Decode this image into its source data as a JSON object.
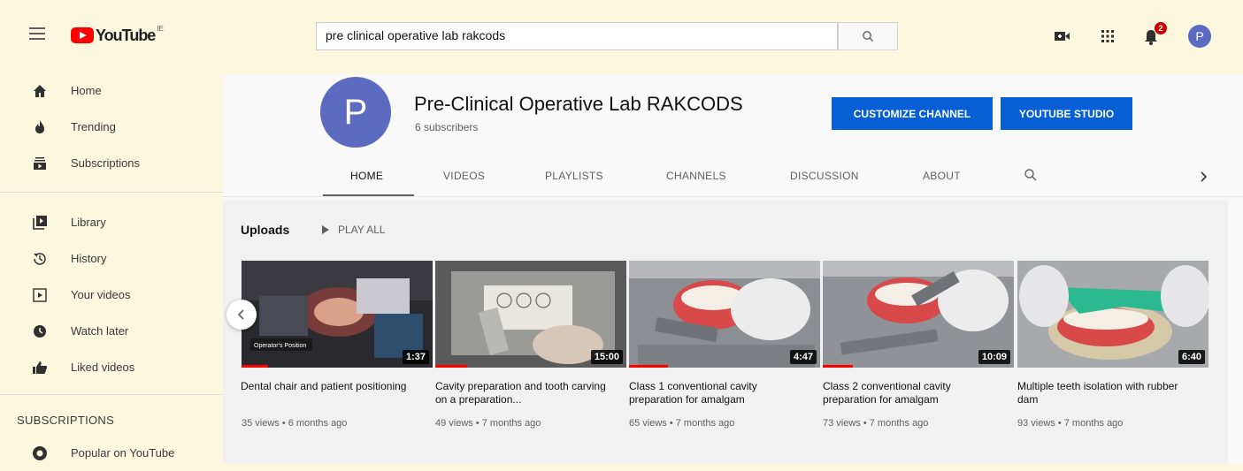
{
  "header": {
    "logo_text": "YouTube",
    "logo_superscript": "IE",
    "search_value": "pre clinical operative lab rakcods",
    "notification_count": "2",
    "avatar_letter": "P"
  },
  "sidebar": {
    "items": [
      {
        "label": "Home",
        "icon": "home-icon"
      },
      {
        "label": "Trending",
        "icon": "fire-icon"
      },
      {
        "label": "Subscriptions",
        "icon": "subscriptions-icon"
      },
      {
        "label": "Library",
        "icon": "library-icon"
      },
      {
        "label": "History",
        "icon": "history-icon"
      },
      {
        "label": "Your videos",
        "icon": "play-square-icon"
      },
      {
        "label": "Watch later",
        "icon": "clock-icon"
      },
      {
        "label": "Liked videos",
        "icon": "thumb-up-icon"
      }
    ],
    "subscriptions_heading": "SUBSCRIPTIONS",
    "subscription_items": [
      {
        "label": "Popular on YouTube"
      }
    ]
  },
  "channel": {
    "avatar_letter": "P",
    "name": "Pre-Clinical Operative Lab RAKCODS",
    "subscribers": "6 subscribers",
    "customize_label": "CUSTOMIZE CHANNEL",
    "studio_label": "YOUTUBE STUDIO",
    "tabs": [
      "HOME",
      "VIDEOS",
      "PLAYLISTS",
      "CHANNELS",
      "DISCUSSION",
      "ABOUT"
    ],
    "active_tab": "HOME"
  },
  "uploads": {
    "title": "Uploads",
    "play_all": "PLAY ALL",
    "videos": [
      {
        "title": "Dental chair and patient positioning",
        "meta": "35 views • 6 months ago",
        "duration": "1:37",
        "thumb_caption": "Operator's Position"
      },
      {
        "title": "Cavity preparation and tooth carving on a preparation...",
        "meta": "49 views • 7 months ago",
        "duration": "15:00"
      },
      {
        "title": "Class 1 conventional cavity preparation for amalgam",
        "meta": "65 views • 7 months ago",
        "duration": "4:47"
      },
      {
        "title": "Class 2 conventional cavity preparation for amalgam",
        "meta": "73 views • 7 months ago",
        "duration": "10:09"
      },
      {
        "title": "Multiple teeth isolation with rubber dam",
        "meta": "93 views • 7 months ago",
        "duration": "6:40"
      }
    ]
  },
  "colors": {
    "brand_red": "#ff0000",
    "button_blue": "#065fd4",
    "avatar_indigo": "#5c6bc0",
    "page_bg": "#fbf8df"
  }
}
